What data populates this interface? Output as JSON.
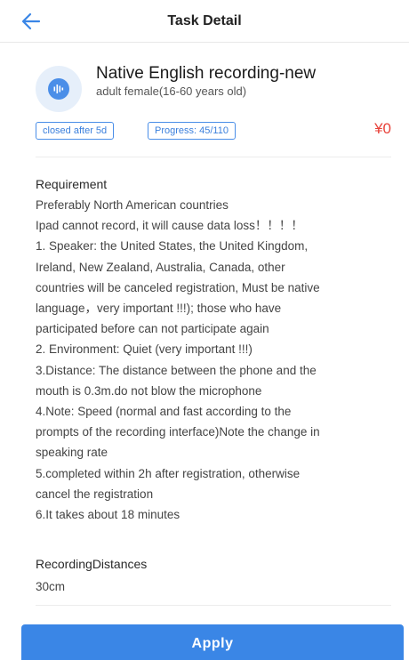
{
  "header": {
    "title": "Task Detail",
    "back_icon": "arrow-left-icon",
    "back_color": "#3a86e6"
  },
  "task": {
    "icon": "audio-waveform-icon",
    "title": "Native English recording-new",
    "subtitle": "adult female(16-60 years old)",
    "closed_badge": "closed after 5d",
    "progress_badge": "Progress: 45/110",
    "progress": {
      "done": 45,
      "total": 110
    },
    "price": "¥0"
  },
  "requirement": {
    "label": "Requirement",
    "lines": [
      "Preferably North American countries",
      "Ipad cannot record, it will cause data loss！！！！",
      "1.  Speaker: the United States, the United Kingdom,",
      "Ireland, New Zealand, Australia, Canada,   other",
      "countries will be canceled registration, Must be native",
      "language，very important !!!); those who have",
      "participated before can not participate again",
      "2. Environment: Quiet (very important !!!)",
      "3.Distance: The distance between the phone and the",
      "mouth is 0.3m.do not blow the microphone",
      "4.Note: Speed (normal and fast according to the",
      "prompts of the recording interface)Note the change in",
      "speaking rate",
      "5.completed within 2h after registration, otherwise",
      "cancel the registration",
      "6.It takes about 18 minutes"
    ]
  },
  "recording_distances": {
    "label": "RecordingDistances",
    "value": "30cm"
  },
  "footer": {
    "apply_label": "Apply"
  },
  "colors": {
    "accent": "#3a86e6",
    "price": "#e8423a"
  }
}
